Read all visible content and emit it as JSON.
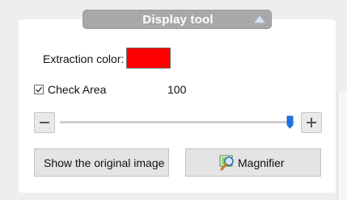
{
  "header": {
    "title": "Display tool",
    "collapse_icon": "triangle-up-icon"
  },
  "extraction": {
    "label": "Extraction color:",
    "color": "#ff0000"
  },
  "check_area": {
    "label": "Check Area",
    "checked": true,
    "value": "100"
  },
  "slider": {
    "decrement_icon": "minus-icon",
    "increment_icon": "plus-icon",
    "level": 1.0
  },
  "buttons": {
    "show_original": "Show the original image",
    "magnifier": "Magnifier",
    "magnifier_icon": "magnifier-icon"
  },
  "colors": {
    "accent": "#1a73e8",
    "header": "#a8a8a8"
  }
}
